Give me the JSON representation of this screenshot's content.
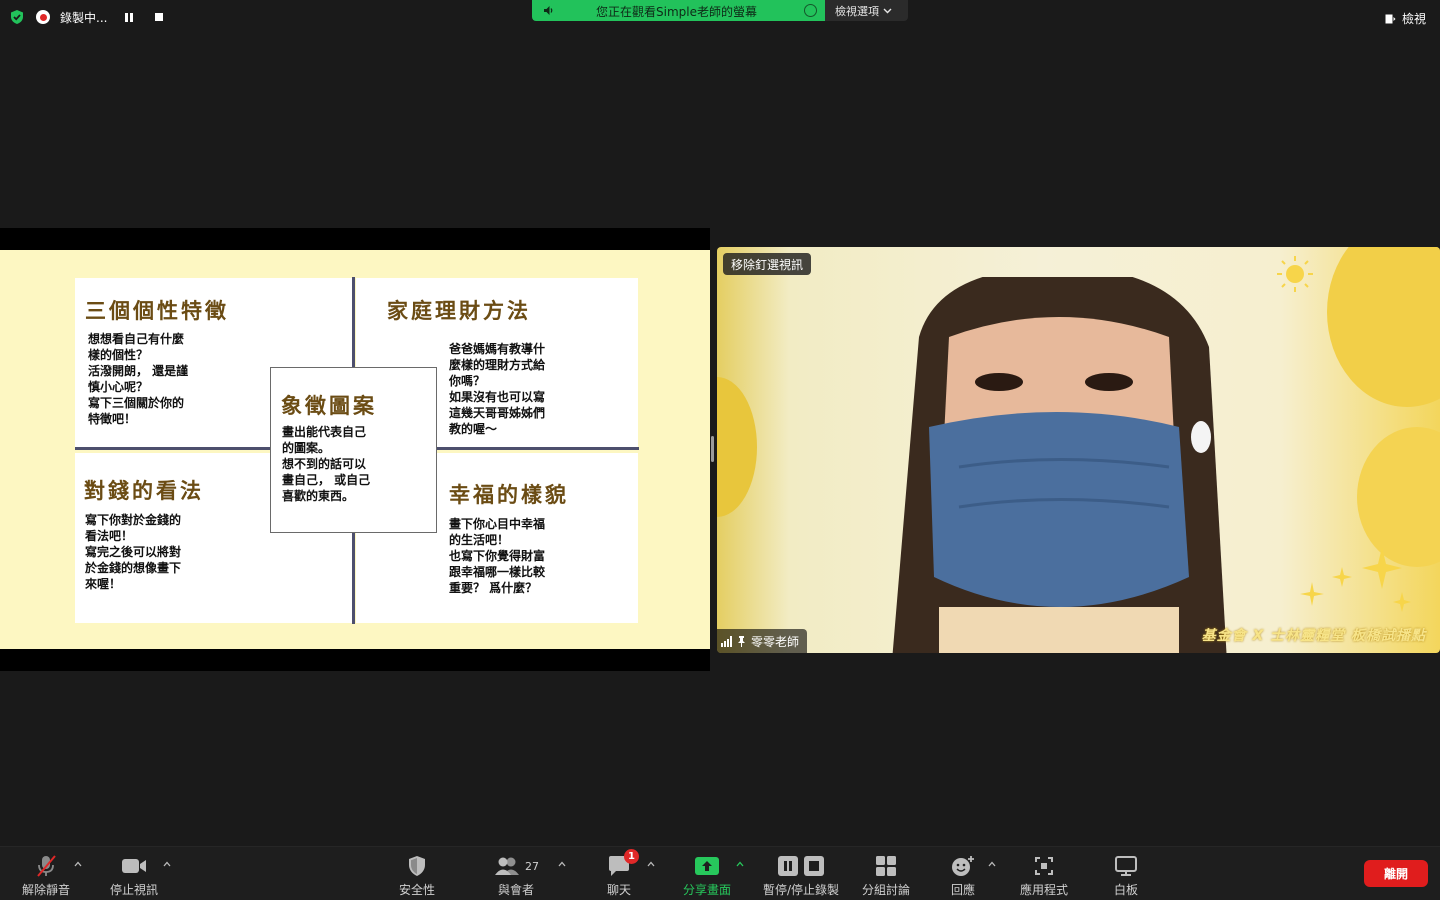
{
  "top_bar": {
    "recording_label": "錄製中...",
    "banner_text": "您正在觀看Simple老師的螢幕",
    "view_options_label": "檢視選項",
    "view_label": "檢視"
  },
  "slide": {
    "top_left": {
      "title": "三個個性特徵",
      "body": "想想看自己有什麼\n樣的個性？\n活潑開朗， 還是謹\n慎小心呢？\n寫下三個關於你的\n特徵吧！"
    },
    "top_right": {
      "title": "家庭理財方法",
      "body": "爸爸媽媽有教導什\n麼樣的理財方式給\n你嗎？\n如果沒有也可以寫\n這幾天哥哥姊姊們\n教的喔～"
    },
    "center": {
      "title": "象徵圖案",
      "body": "畫出能代表自己\n的圖案。\n想不到的話可以\n畫自己， 或自己\n喜歡的東西。"
    },
    "bottom_left": {
      "title": "對錢的看法",
      "body": "寫下你對於金錢的\n看法吧！\n寫完之後可以將對\n於金錢的想像畫下\n來喔！"
    },
    "bottom_right": {
      "title": "幸福的樣貌",
      "body": "畫下你心目中幸福\n的生活吧！\n也寫下你覺得財富\n跟幸福哪一樣比較\n重要？ 爲什麼？"
    }
  },
  "video": {
    "unpin_label": "移除釘選視訊",
    "participant_name": "零零老師",
    "watermark": "基金會 X 士林靈糧堂 板橋試播點"
  },
  "toolbar": {
    "unmute": "解除靜音",
    "stop_video": "停止視訊",
    "security": "安全性",
    "participants": "與會者",
    "participant_count": "27",
    "chat": "聊天",
    "chat_badge": "1",
    "share_screen": "分享畫面",
    "pause_stop_recording": "暫停/停止錄製",
    "breakout_rooms": "分組討論",
    "reactions": "回應",
    "apps": "應用程式",
    "whiteboard": "白板",
    "leave": "離開"
  },
  "colors": {
    "accent_green": "#27c85c",
    "leave_red": "#e01d1d",
    "slide_bg": "#fdf7c2",
    "slide_title": "#6b4c14"
  }
}
